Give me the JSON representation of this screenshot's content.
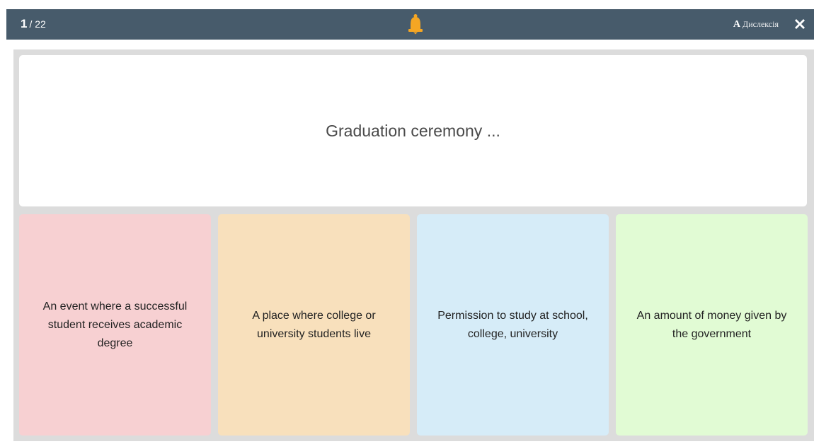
{
  "header": {
    "current": "1",
    "total": "/ 22",
    "font_toggle_letter": "A",
    "font_toggle_label": "Дислексія",
    "bell_icon": "bell-icon",
    "close_icon": "close-icon",
    "bar_color": "#475b6b",
    "bell_color": "#f5a623"
  },
  "question": {
    "text": "Graduation ceremony ..."
  },
  "answers": [
    {
      "label": "An event where a successful student receives academic degree",
      "color": "#f7d0d2"
    },
    {
      "label": "A place where college or university students live",
      "color": "#f8e0bc"
    },
    {
      "label": "Permission to study at school, college, university",
      "color": "#d6ecf8"
    },
    {
      "label": "An amount of money given by the government",
      "color": "#e1fbd4"
    }
  ]
}
